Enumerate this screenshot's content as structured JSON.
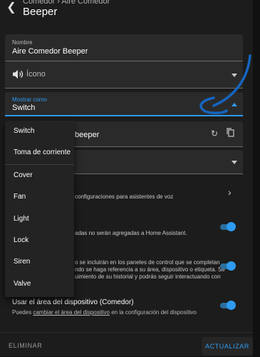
{
  "header": {
    "breadcrumb": "Comedor › Aire Comedor",
    "title": "Beeper"
  },
  "name_field": {
    "label": "Nombre",
    "value": "Aire Comedor Beeper"
  },
  "icon_field": {
    "placeholder": "Ícono",
    "icon": "speaker-icon"
  },
  "show_as_field": {
    "label": "Mostrar como",
    "value": "Switch"
  },
  "entity_id_suffix": "beeper",
  "dropdown": {
    "items": [
      "Switch",
      "Toma de corriente",
      "Cover",
      "Fan",
      "Light",
      "Lock",
      "Siren",
      "Valve"
    ]
  },
  "voice": {
    "text": "configuraciones para asistentes de voz"
  },
  "enabled": {
    "text": "adas no serán agregadas a Home Assistant."
  },
  "visible": {
    "line1": "o se incluirán en los paneles de control que se completan",
    "line2": "ndo se haga referencia a su área, dispositivo o etiqueta. Se",
    "line3": "uimiento de su historial y podrás seguir interactuando con",
    "line4": ""
  },
  "device_area": {
    "title": "Usar el área del dispositivo (Comedor)",
    "desc_prefix": "Puedes ",
    "desc_link": "cambiar el área del dispositivo",
    "desc_suffix": " en la configuración del dispositivo"
  },
  "footer": {
    "delete_label": "ELIMINAR",
    "update_label": "ACTUALIZAR"
  },
  "colors": {
    "accent": "#2e9bf1",
    "annotation": "#1565c0"
  }
}
